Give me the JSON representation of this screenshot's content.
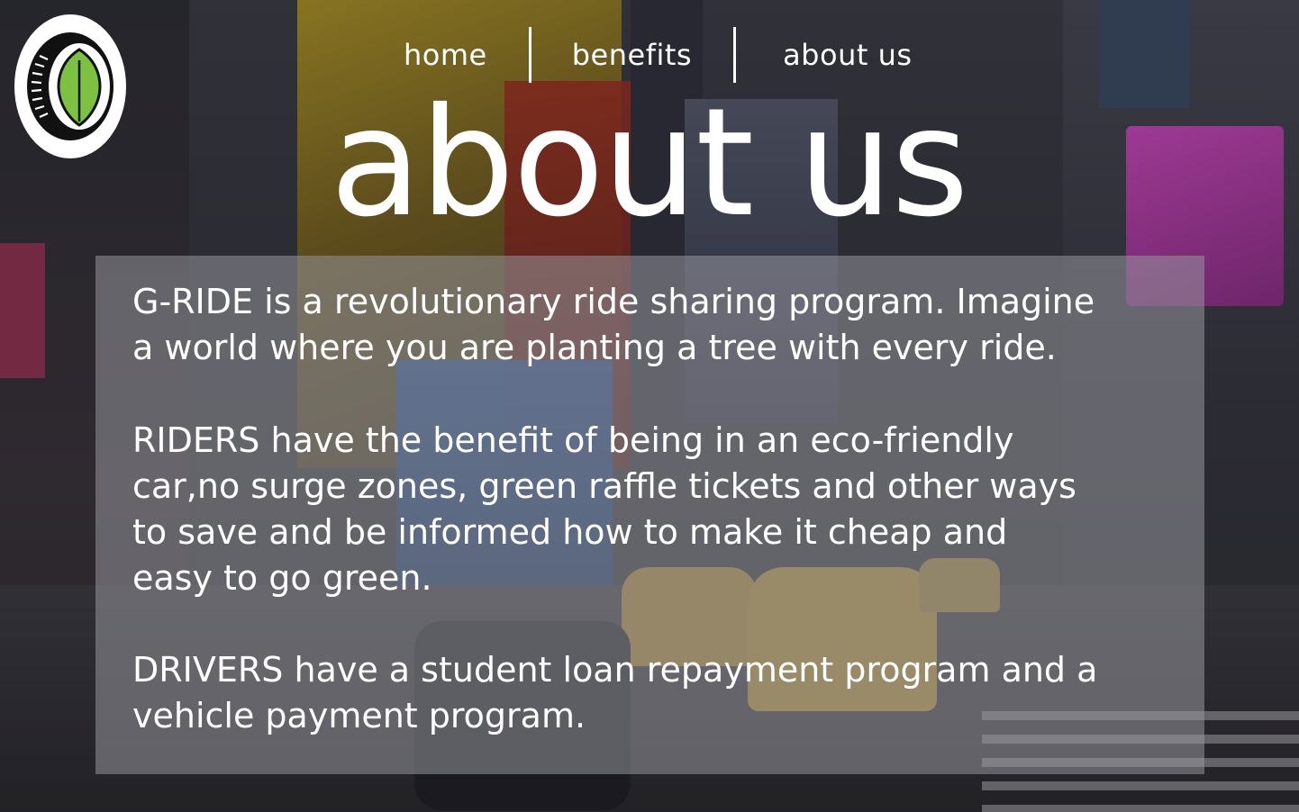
{
  "nav": {
    "items": [
      {
        "label": "home"
      },
      {
        "label": "benefits"
      },
      {
        "label": "about us"
      }
    ]
  },
  "page": {
    "title": "about us"
  },
  "content": {
    "paragraph1": [
      "G-RIDE is a revolutionary ride sharing program. Imagine",
      "a world where you are planting a tree with every ride."
    ],
    "paragraph2": [
      "RIDERS have the benefit of being in an  eco-friendly",
      "car,no surge zones, green raffle tickets and other ways",
      "to save and be informed how to make it cheap and",
      "easy to go green."
    ],
    "paragraph3": [
      "DRIVERS have a student loan repayment program and a",
      "vehicle payment program."
    ]
  },
  "icons": {
    "logo": "tire-leaf-logo-icon"
  },
  "colors": {
    "text": "#ffffff",
    "leaf_green": "#7dc142",
    "panel_overlay": "rgba(150,150,156,0.55)"
  }
}
